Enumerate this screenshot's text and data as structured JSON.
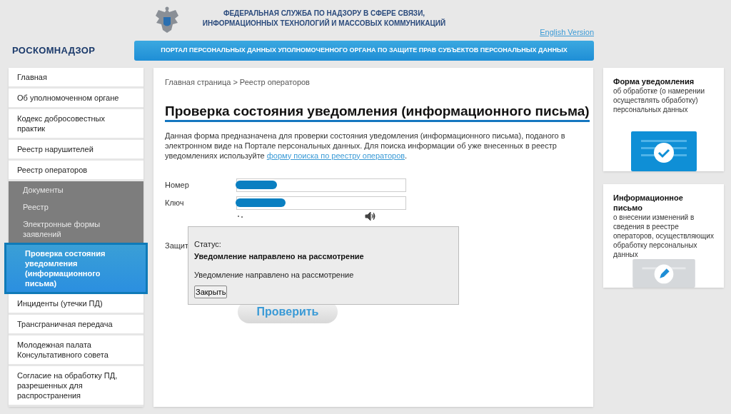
{
  "header": {
    "agency": "ФЕДЕРАЛЬНАЯ СЛУЖБА ПО НАДЗОРУ В СФЕРЕ СВЯЗИ, ИНФОРМАЦИОННЫХ ТЕХНОЛОГИЙ И МАССОВЫХ КОММУНИКАЦИЙ",
    "language_link": "English Version",
    "logo": "РОСКОМНАДЗОР",
    "portal_banner": "ПОРТАЛ ПЕРСОНАЛЬНЫХ ДАННЫХ УПОЛНОМОЧЕННОГО ОРГАНА ПО ЗАЩИТЕ ПРАВ СУБЪЕКТОВ ПЕРСОНАЛЬНЫХ ДАННЫХ"
  },
  "sidebar": {
    "items": [
      {
        "label": "Главная",
        "kind": "main",
        "selected": false
      },
      {
        "label": "Об уполномоченном органе",
        "kind": "main",
        "selected": false
      },
      {
        "label": "Кодекс добросовестных практик",
        "kind": "main",
        "selected": false
      },
      {
        "label": "Реестр нарушителей",
        "kind": "main",
        "selected": false
      },
      {
        "label": "Реестр операторов",
        "kind": "main",
        "selected": false
      },
      {
        "label": "Документы",
        "kind": "sub",
        "selected": false
      },
      {
        "label": "Реестр",
        "kind": "sub",
        "selected": false
      },
      {
        "label": "Электронные формы заявлений",
        "kind": "sub",
        "selected": false
      },
      {
        "label": "Проверка состояния уведомления (информационного письма)",
        "kind": "sub",
        "selected": true
      },
      {
        "label": "Инциденты (утечки ПД)",
        "kind": "main",
        "selected": false
      },
      {
        "label": "Трансграничная передача",
        "kind": "main",
        "selected": false
      },
      {
        "label": "Молодежная палата Консультативного совета",
        "kind": "main",
        "selected": false
      },
      {
        "label": "Согласие на обработку ПД, разрешенных для распространения",
        "kind": "main",
        "selected": false
      }
    ]
  },
  "breadcrumb": "Главная страница > Реестр операторов",
  "page_title": "Проверка состояния уведомления (информационного письма)",
  "intro": {
    "text": "Данная форма предназначена для проверки состояния уведомления (информационного письма), поданого в электронном виде на Портале персональных данных. Для поиска информации об уже внесенных в реестр уведомлениях используйте",
    "link": "форму поиска по реестру операторов",
    "end": "."
  },
  "form": {
    "fields": [
      {
        "label": "Номер",
        "redacted": true
      },
      {
        "label": "Ключ",
        "redacted": true
      }
    ],
    "captcha_label": "Защит",
    "submit": "Проверить"
  },
  "dialog": {
    "status_label": "Статус:",
    "status": "Уведомление направлено на рассмотрение",
    "message": "Уведомление направлено на рассмотрение",
    "close": "Закрыть"
  },
  "cards": [
    {
      "title": "Форма уведомления",
      "text": "об обработке (о намерении осуществлять обработку) персональных данных",
      "kind": "check"
    },
    {
      "title": "Информационное письмо",
      "text": "о внесении изменений в сведения в реестре операторов, осуществляющих обработку персональных данных",
      "kind": "edit"
    }
  ]
}
